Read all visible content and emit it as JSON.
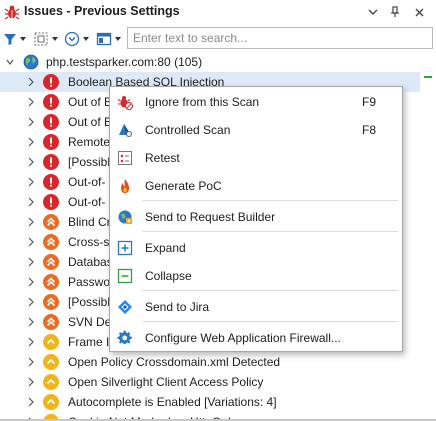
{
  "panel": {
    "title": "Issues - Previous Settings",
    "title_buttons": [
      {
        "name": "dropdown-button",
        "glyph": "▾"
      },
      {
        "name": "pin-button",
        "glyph": "⊥"
      },
      {
        "name": "close-button",
        "glyph": "✕"
      }
    ]
  },
  "toolbar": {
    "search_placeholder": "Enter text to search..."
  },
  "tree": {
    "root": {
      "label": "php.testsparker.com:80 (105)"
    },
    "items": [
      {
        "label": "Boolean Based SQL Injection",
        "severity": "high"
      },
      {
        "label": "Out of B",
        "severity": "high"
      },
      {
        "label": "Out of B",
        "severity": "high"
      },
      {
        "label": "Remote",
        "severity": "high"
      },
      {
        "label": "[Possibl",
        "severity": "high"
      },
      {
        "label": "Out-of-",
        "severity": "high"
      },
      {
        "label": "Out-of-",
        "severity": "high"
      },
      {
        "label": "Blind Cr",
        "severity": "medium"
      },
      {
        "label": "Cross-si",
        "severity": "medium"
      },
      {
        "label": "Databas",
        "severity": "medium"
      },
      {
        "label": "Passwor",
        "severity": "medium"
      },
      {
        "label": "[Possibl",
        "severity": "medium"
      },
      {
        "label": "SVN Det",
        "severity": "medium"
      },
      {
        "label": "Frame In",
        "severity": "low"
      },
      {
        "label": "Open Policy Crossdomain.xml Detected",
        "severity": "low"
      },
      {
        "label": "Open Silverlight Client Access Policy",
        "severity": "low"
      },
      {
        "label": "Autocomplete is Enabled [Variations: 4]",
        "severity": "low"
      },
      {
        "label": "Cookie Not Marked as HttpOnly",
        "severity": "low"
      }
    ]
  },
  "context_menu": {
    "items": [
      {
        "label": "Ignore from this Scan",
        "shortcut": "F9",
        "icon": "bug-ignore-icon"
      },
      {
        "label": "Controlled Scan",
        "shortcut": "F8",
        "icon": "controlled-scan-icon"
      },
      {
        "label": "Retest",
        "shortcut": "",
        "icon": "retest-icon"
      },
      {
        "label": "Generate PoC",
        "shortcut": "",
        "icon": "flame-icon"
      },
      {
        "label": "Send to Request Builder",
        "shortcut": "",
        "icon": "request-builder-icon"
      },
      {
        "label": "Expand",
        "shortcut": "",
        "icon": "expand-icon"
      },
      {
        "label": "Collapse",
        "shortcut": "",
        "icon": "collapse-icon"
      },
      {
        "label": "Send to Jira",
        "shortcut": "",
        "icon": "jira-icon"
      },
      {
        "label": "Configure Web Application Firewall...",
        "shortcut": "",
        "icon": "gear-icon"
      }
    ]
  },
  "colors": {
    "severity_high": "#d9262b",
    "severity_medium": "#ee6a1e",
    "severity_low": "#f1b51c",
    "selection": "#dde9f7"
  }
}
